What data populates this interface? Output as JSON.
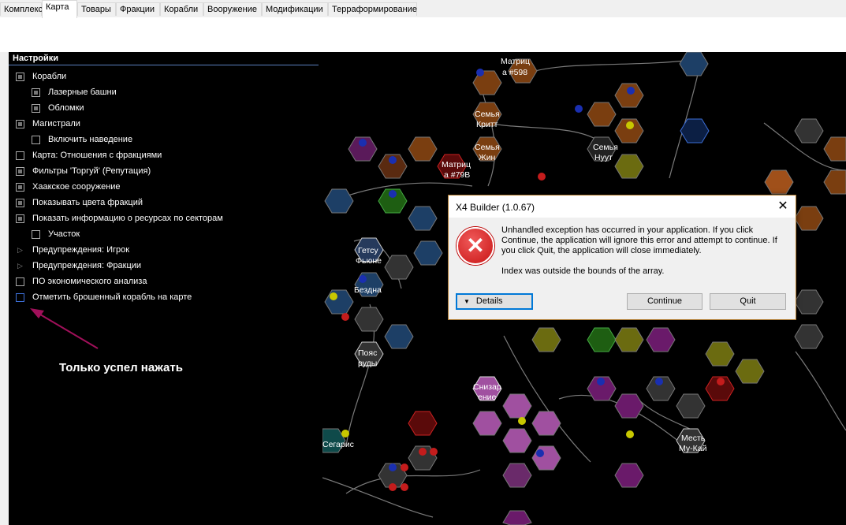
{
  "tabs": [
    "Комплекс",
    "Карта",
    "Товары",
    "Фракции",
    "Корабли",
    "Вооружение",
    "Модификации",
    "Терраформирование"
  ],
  "settings": {
    "title": "Настройки",
    "options": [
      {
        "label": "Корабли",
        "checked": true
      },
      {
        "label": "Лазерные башни",
        "checked": true
      },
      {
        "label": "Обломки",
        "checked": true
      },
      {
        "label": "Магистрали",
        "checked": true
      },
      {
        "label": "Включить наведение",
        "checked": false
      },
      {
        "label": "Карта: Отношения с фракциями",
        "checked": false
      },
      {
        "label": "Фильтры 'Торгуй' (Репутация)",
        "checked": true
      },
      {
        "label": "Хаакское сооружение",
        "checked": true
      },
      {
        "label": "Показывать цвета фракций",
        "checked": true
      },
      {
        "label": "Показать информацию о ресурсах по секторам",
        "checked": true
      },
      {
        "label": "Участок",
        "checked": false
      },
      {
        "label": "Предупреждения: Игрок",
        "expander": true
      },
      {
        "label": "Предупреждения: Фракции",
        "expander": true
      },
      {
        "label": "ПО экономического анализа",
        "checked": false
      },
      {
        "label": "Отметить брошенный корабль на карте",
        "checked": false
      }
    ]
  },
  "annotation": "Только успел нажать",
  "map_labels": [
    "Матриц",
    "а #598",
    "Семья",
    "Критт",
    "Семья",
    "Жин",
    "Семья",
    "Нуут",
    "Матриц",
    "а #79В",
    "Гетсу",
    "Фьюне",
    "Бездна",
    "Пояс",
    "руды",
    "Снизар",
    "ение",
    "Месть",
    "Му-Кай",
    "Сегарис"
  ],
  "dialog": {
    "title": "X4 Builder (1.0.67)",
    "message_lines": [
      "Unhandled exception has occurred in your application. If you click",
      "Continue, the application will ignore this error and attempt to continue. If",
      "you click Quit, the application will close immediately."
    ],
    "detail": "Index was outside the bounds of the array.",
    "details_label": "Details",
    "continue_label": "Continue",
    "quit_label": "Quit",
    "close_symbol": "✕"
  },
  "colors": {
    "panel_bg": "#000000",
    "accent": "#0078d7",
    "annotation_arrow": "#a0105a"
  }
}
